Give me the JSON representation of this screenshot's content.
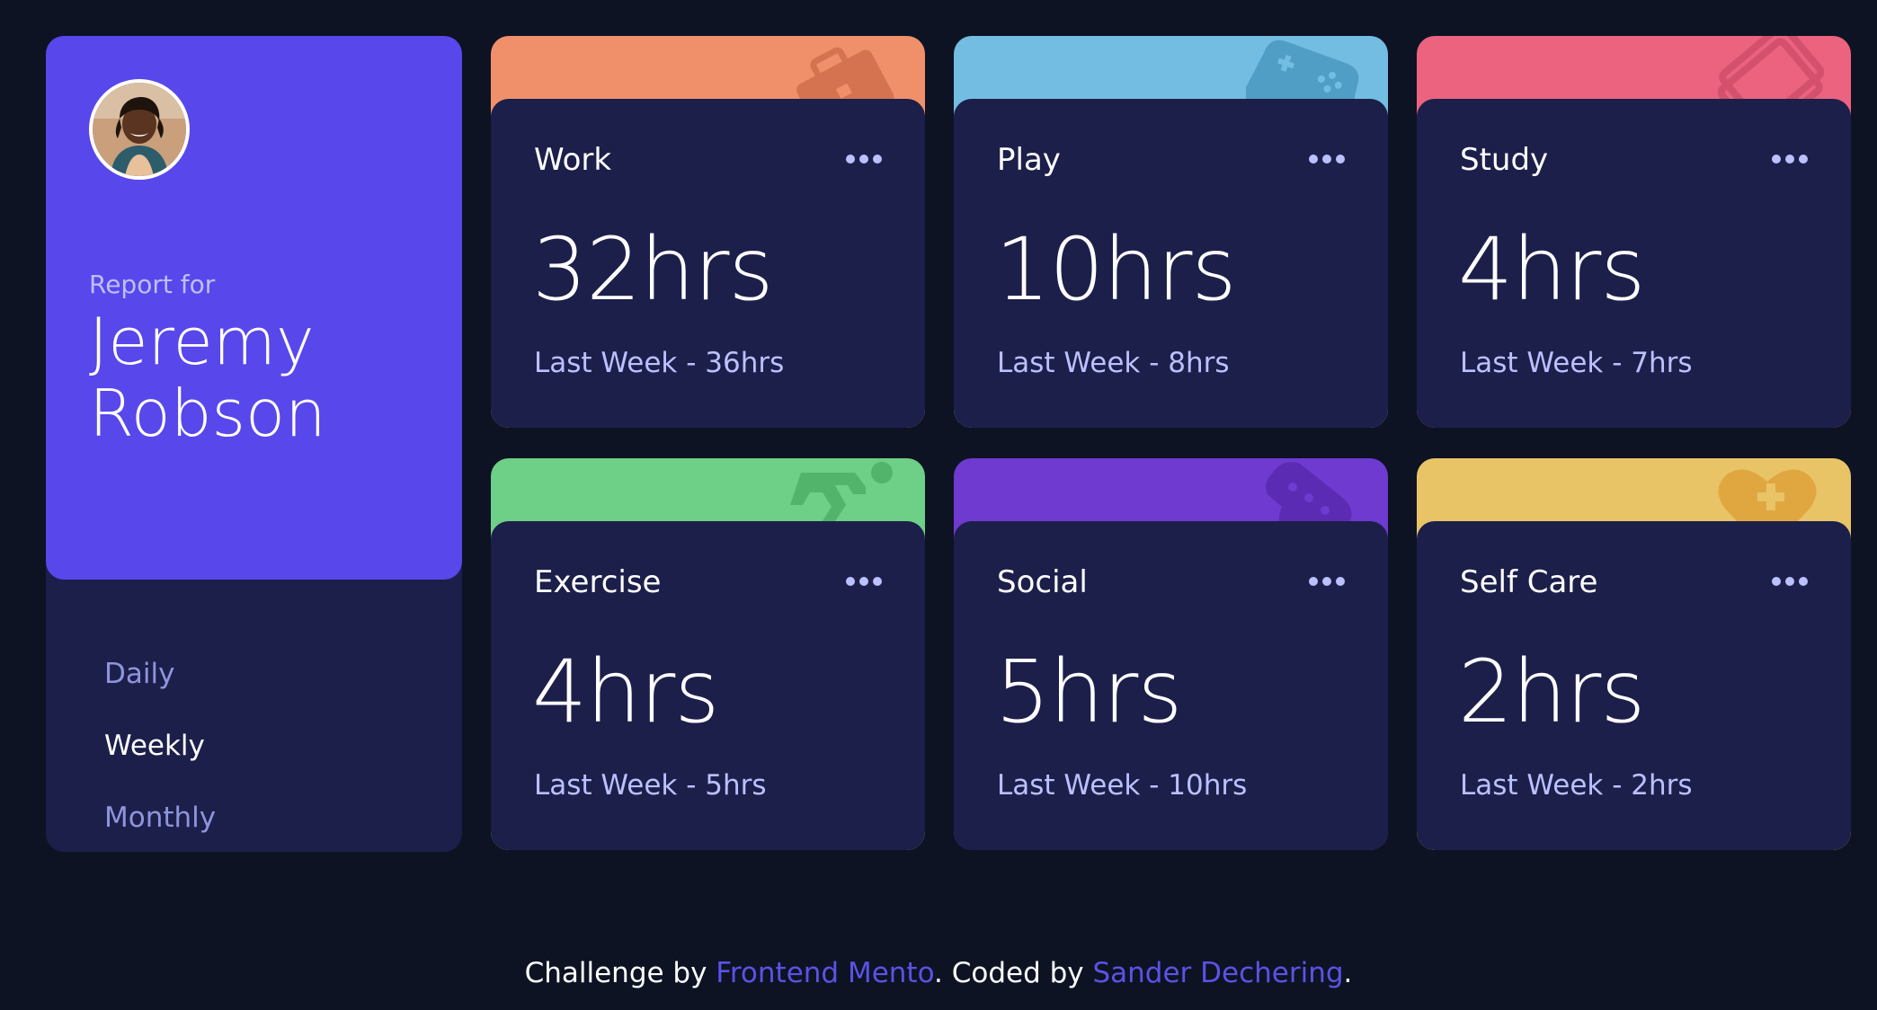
{
  "profile": {
    "report_label": "Report for",
    "name": "Jeremy Robson",
    "avatar": "avatar-photo"
  },
  "timeframes": [
    {
      "label": "Daily",
      "active": false
    },
    {
      "label": "Weekly",
      "active": true
    },
    {
      "label": "Monthly",
      "active": false
    }
  ],
  "activities": [
    {
      "title": "Work",
      "current": "32hrs",
      "previous": "Last Week - 36hrs",
      "color": "#f0906b",
      "icon": "briefcase-icon"
    },
    {
      "title": "Play",
      "current": "10hrs",
      "previous": "Last Week - 8hrs",
      "color": "#73bde3",
      "icon": "gamepad-icon"
    },
    {
      "title": "Study",
      "current": "4hrs",
      "previous": "Last Week - 7hrs",
      "color": "#ec6380",
      "icon": "book-icon"
    },
    {
      "title": "Exercise",
      "current": "4hrs",
      "previous": "Last Week - 5hrs",
      "color": "#6ecf86",
      "icon": "running-icon"
    },
    {
      "title": "Social",
      "current": "5hrs",
      "previous": "Last Week - 10hrs",
      "color": "#6e3ad0",
      "icon": "chat-icon"
    },
    {
      "title": "Self Care",
      "current": "2hrs",
      "previous": "Last Week - 2hrs",
      "color": "#e8c466",
      "icon": "heart-icon"
    }
  ],
  "footer": {
    "prefix": "Challenge by ",
    "link1": "Frontend Mento",
    "middle": ". Coded by ",
    "link2": "Sander Dechering",
    "suffix": "."
  },
  "colors": {
    "background": "#0d1323",
    "card": "#1c1f4a",
    "accent": "#5847eb",
    "muted": "#bbc0ff"
  }
}
